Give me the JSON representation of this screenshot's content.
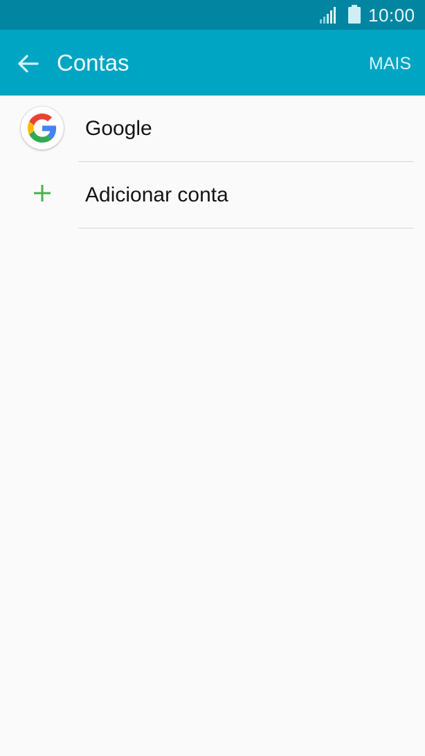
{
  "status_bar": {
    "time": "10:00",
    "icons": [
      "signal-icon",
      "battery-icon"
    ]
  },
  "app_bar": {
    "title": "Contas",
    "back_icon": "arrow-left-icon",
    "more_label": "MAIS"
  },
  "accounts": {
    "items": [
      {
        "label": "Google",
        "icon": "google-logo-icon"
      },
      {
        "label": "Adicionar conta",
        "icon": "plus-icon"
      }
    ]
  },
  "colors": {
    "status_bar": "#0185a0",
    "app_bar": "#00a5c3",
    "background": "#fafafa",
    "accent_plus": "#4caf50"
  }
}
